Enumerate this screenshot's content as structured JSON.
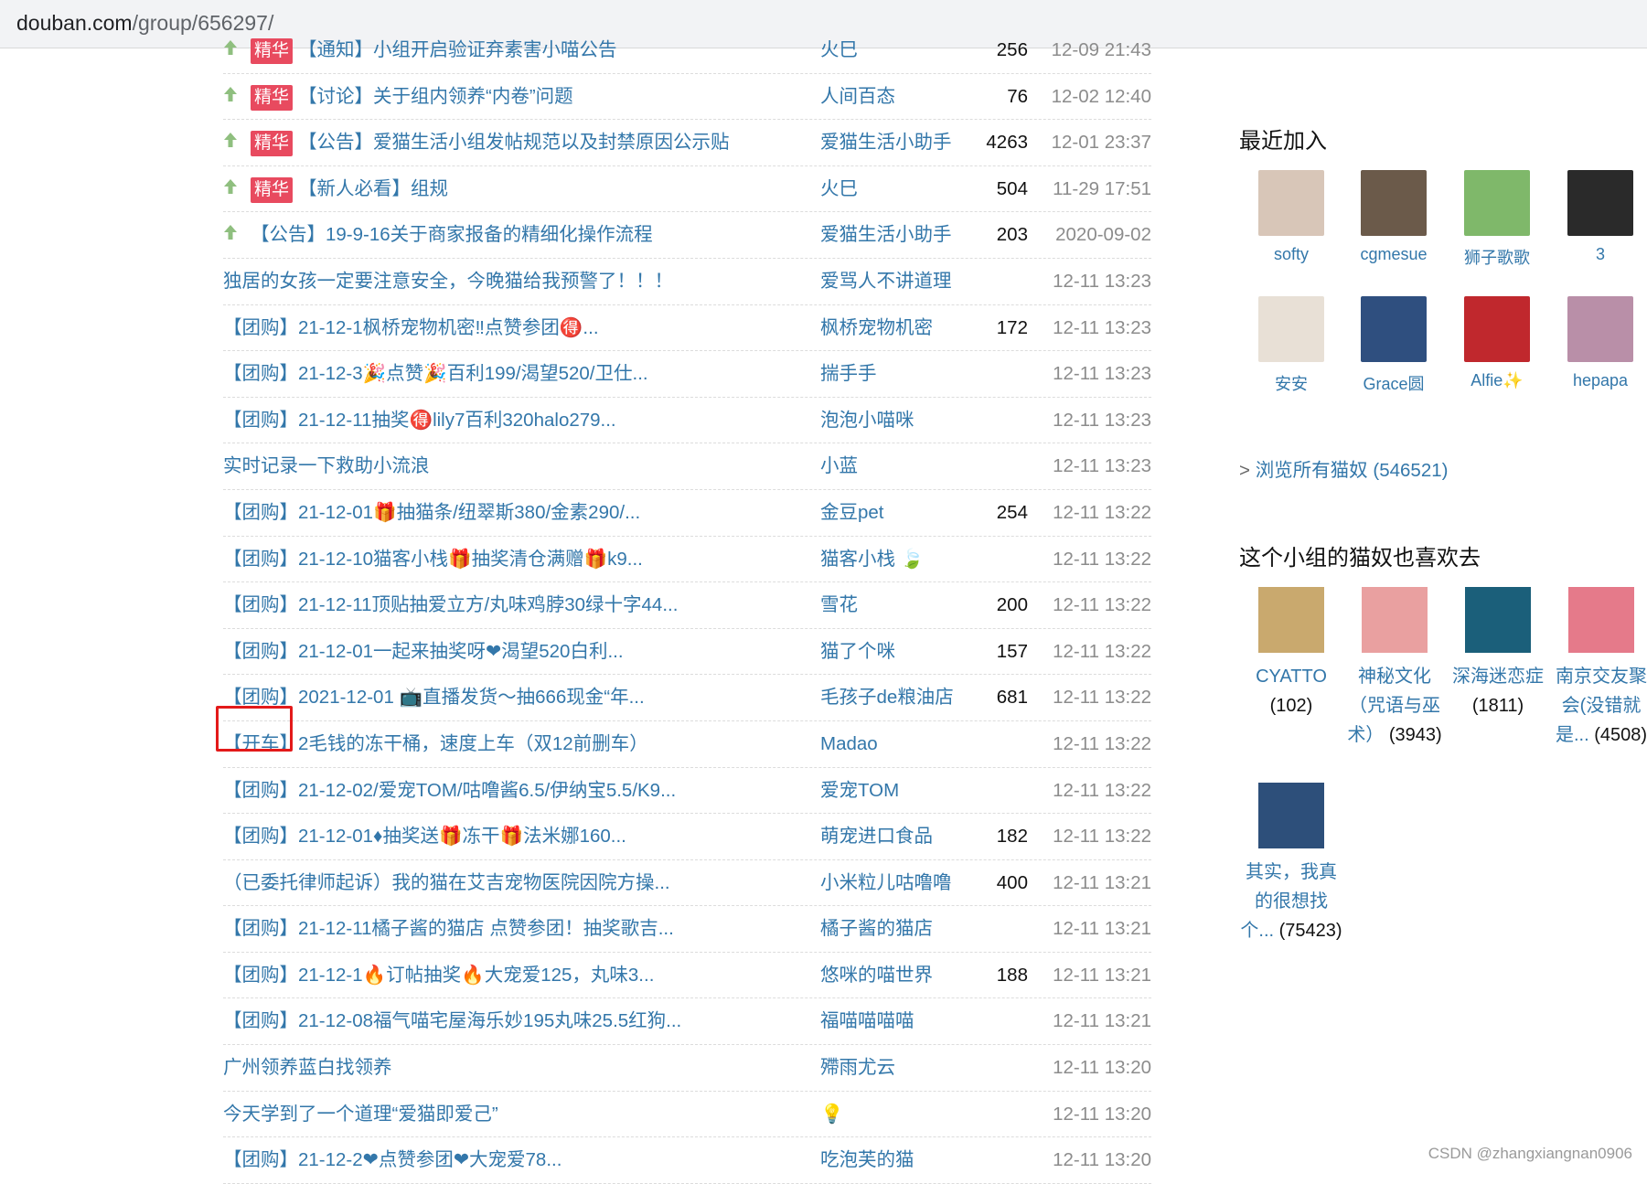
{
  "browser": {
    "url_domain": "douban.com",
    "url_path": "/group/656297/"
  },
  "topics": [
    {
      "pinned": true,
      "essence": true,
      "title": "【通知】小组开启验证弃素害小喵公告",
      "author": "火巳",
      "count": "256",
      "time": "12-09 21:43"
    },
    {
      "pinned": true,
      "essence": true,
      "title": "【讨论】关于组内领养“内卷”问题",
      "author": "人间百态",
      "count": "76",
      "time": "12-02 12:40"
    },
    {
      "pinned": true,
      "essence": true,
      "title": "【公告】爱猫生活小组发帖规范以及封禁原因公示贴",
      "author": "爱猫生活小助手",
      "count": "4263",
      "time": "12-01 23:37"
    },
    {
      "pinned": true,
      "essence": true,
      "title": "【新人必看】组规",
      "author": "火巳",
      "count": "504",
      "time": "11-29 17:51"
    },
    {
      "pinned": true,
      "essence": false,
      "title": "【公告】19-9-16关于商家报备的精细化操作流程",
      "author": "爱猫生活小助手",
      "count": "203",
      "time": "2020-09-02"
    },
    {
      "pinned": false,
      "essence": false,
      "title": "独居的女孩一定要注意安全，今晚猫给我预警了！！！",
      "author": "爱骂人不讲道理",
      "count": "",
      "time": "12-11 13:23"
    },
    {
      "pinned": false,
      "essence": false,
      "title": "【团购】21-12-1枫桥宠物机密‼点赞参团🉐...",
      "author": "枫桥宠物机密",
      "count": "172",
      "time": "12-11 13:23"
    },
    {
      "pinned": false,
      "essence": false,
      "title": "【团购】21-12-3🎉点赞🎉百利199/渴望520/卫仕...",
      "author": "揣手手",
      "count": "",
      "time": "12-11 13:23"
    },
    {
      "pinned": false,
      "essence": false,
      "title": "【团购】21-12-11抽奖🉐lily7百利320halo279...",
      "author": "泡泡小喵咪",
      "count": "",
      "time": "12-11 13:23"
    },
    {
      "pinned": false,
      "essence": false,
      "title": "实时记录一下救助小流浪",
      "author": "小蓝",
      "count": "",
      "time": "12-11 13:23"
    },
    {
      "pinned": false,
      "essence": false,
      "title": "【团购】21-12-01🎁抽猫条/纽翠斯380/金素290/...",
      "author": "金豆pet",
      "count": "254",
      "time": "12-11 13:22"
    },
    {
      "pinned": false,
      "essence": false,
      "title": "【团购】21-12-10猫客小栈🎁抽奖清仓满赠🎁k9...",
      "author": "猫客小栈 🍃",
      "count": "",
      "time": "12-11 13:22"
    },
    {
      "pinned": false,
      "essence": false,
      "title": "【团购】21-12-11顶贴抽爱立方/丸味鸡脖30绿十字44...",
      "author": "雪花",
      "count": "200",
      "time": "12-11 13:22"
    },
    {
      "pinned": false,
      "essence": false,
      "title": "【团购】21-12-01一起来抽奖呀❤渴望520白利...",
      "author": "猫了个咪",
      "count": "157",
      "time": "12-11 13:22"
    },
    {
      "pinned": false,
      "essence": false,
      "title": "【团购】2021-12-01 📺直播发货～抽666现金“年...",
      "author": "毛孩子de粮油店",
      "count": "681",
      "time": "12-11 13:22"
    },
    {
      "pinned": false,
      "essence": false,
      "title": "【开车】2毛钱的冻干桶，速度上车（双12前删车）",
      "author": "Madao",
      "count": "",
      "time": "12-11 13:22"
    },
    {
      "pinned": false,
      "essence": false,
      "title": "【团购】21-12-02/爱宠TOM/咕噜酱6.5/伊纳宝5.5/K9...",
      "author": "爱宠TOM",
      "count": "",
      "time": "12-11 13:22"
    },
    {
      "pinned": false,
      "essence": false,
      "title": "【团购】21-12-01♦抽奖送🎁冻干🎁法米娜160...",
      "author": "萌宠进口食品",
      "count": "182",
      "time": "12-11 13:22"
    },
    {
      "pinned": false,
      "essence": false,
      "title": "（已委托律师起诉）我的猫在艾吉宠物医院因院方操...",
      "author": "小米粒儿咕噜噜",
      "count": "400",
      "time": "12-11 13:21"
    },
    {
      "pinned": false,
      "essence": false,
      "title": "【团购】21-12-11橘子酱的猫店 点赞参团！抽奖歌吉...",
      "author": "橘子酱的猫店",
      "count": "",
      "time": "12-11 13:21"
    },
    {
      "pinned": false,
      "essence": false,
      "title": "【团购】21-12-1🔥订帖抽奖🔥大宠爱125，丸味3...",
      "author": "悠咪的喵世界",
      "count": "188",
      "time": "12-11 13:21"
    },
    {
      "pinned": false,
      "essence": false,
      "title": "【团购】21-12-08福气喵宅屋海乐妙195丸味25.5红狗...",
      "author": "福喵喵喵喵",
      "count": "",
      "time": "12-11 13:21"
    },
    {
      "pinned": false,
      "essence": false,
      "title": "广州领养蓝白找领养",
      "author": "殢雨尤云",
      "count": "",
      "time": "12-11 13:20"
    },
    {
      "pinned": false,
      "essence": false,
      "title": "今天学到了一个道理“爱猫即爱己”",
      "author": "💡",
      "count": "",
      "time": "12-11 13:20"
    },
    {
      "pinned": false,
      "essence": false,
      "title": "【团购】21-12-2❤点赞参团❤大宠爱78...",
      "author": "吃泡芙的猫",
      "count": "",
      "time": "12-11 13:20"
    }
  ],
  "badge_label": "精华",
  "sidebar": {
    "recent_title": "最近加入",
    "members": [
      {
        "name": "softy",
        "color": "#d8c6b8"
      },
      {
        "name": "cgmesue",
        "color": "#6b5a4a"
      },
      {
        "name": "狮子歌歌",
        "color": "#7fb86a"
      },
      {
        "name": "3",
        "color": "#2a2a2a"
      },
      {
        "name": "安安",
        "color": "#e8e0d6"
      },
      {
        "name": "Grace圆",
        "color": "#2f4f7f"
      },
      {
        "name": "Alfie✨",
        "color": "#c0282d"
      },
      {
        "name": "hepapa",
        "color": "#b98fa8"
      }
    ],
    "browse_arrow": ">",
    "browse_text": "浏览所有猫奴 (546521)",
    "groups_title": "这个小组的猫奴也喜欢去",
    "groups": [
      {
        "name": "CYATTO",
        "count": "(102)",
        "color": "#c9a96e"
      },
      {
        "name": "神秘文化（咒语与巫术）",
        "count": "(3943)",
        "color": "#e9a0a0"
      },
      {
        "name": "深海迷恋症",
        "count": "(1811)",
        "color": "#1b5f7a"
      },
      {
        "name": "南京交友聚会(没错就是...",
        "count": "(4508)",
        "color": "#e57a8a"
      },
      {
        "name": "其实，我真的很想找个...",
        "count": "(75423)",
        "color": "#2d4f7a"
      }
    ]
  },
  "watermark": "CSDN @zhangxiangnan0906"
}
